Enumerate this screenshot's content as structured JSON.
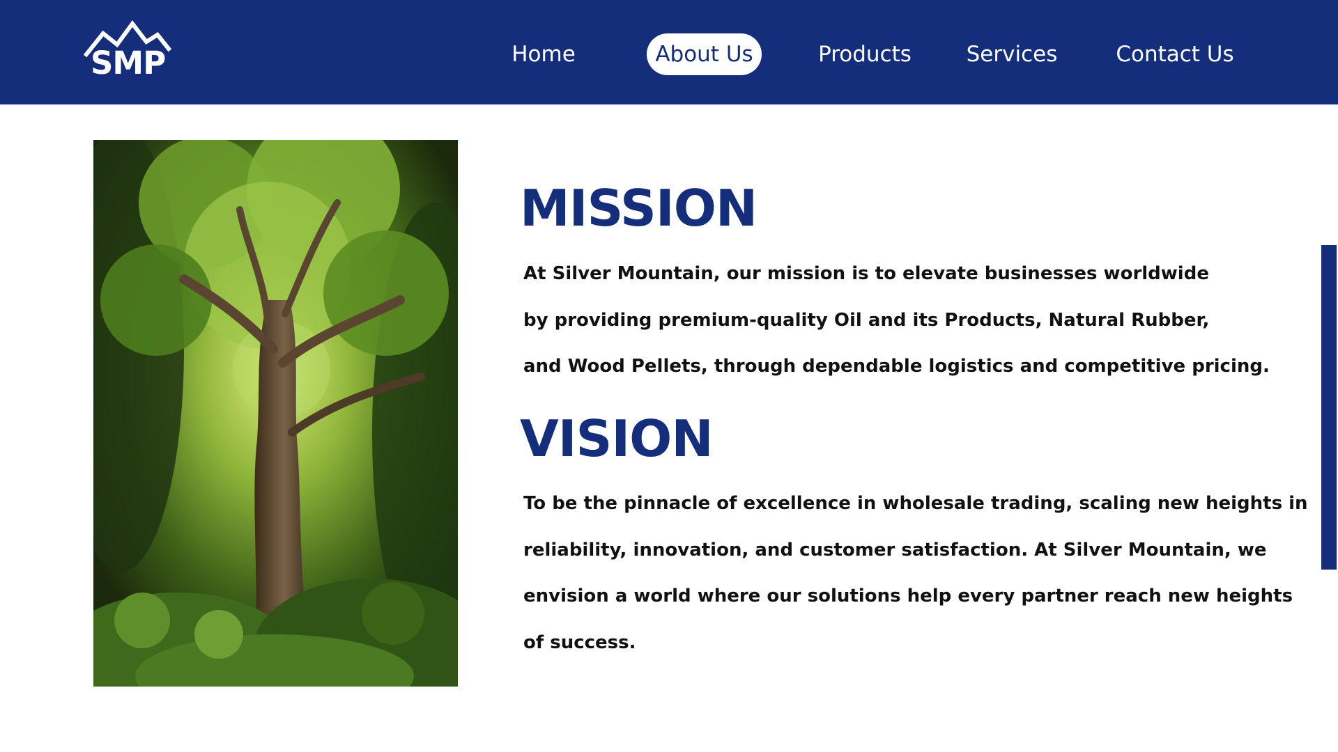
{
  "header": {
    "logo_text": "SMP",
    "nav": [
      {
        "label": "Home",
        "active": false
      },
      {
        "label": "About Us",
        "active": true
      },
      {
        "label": "Products",
        "active": false
      },
      {
        "label": "Services",
        "active": false
      },
      {
        "label": "Contact Us",
        "active": false
      }
    ]
  },
  "main": {
    "image": {
      "subject": "tree-in-forest-photo"
    },
    "mission": {
      "title": "MISSION",
      "lines": [
        "At Silver Mountain, our mission is to elevate businesses worldwide",
        "by providing premium-quality Oil and its Products, Natural Rubber,",
        "and Wood Pellets, through dependable logistics and competitive pricing."
      ]
    },
    "vision": {
      "title": "VISION",
      "lines": [
        "To be the pinnacle of excellence in wholesale trading, scaling new heights in",
        "reliability, innovation, and customer satisfaction. At Silver Mountain, we",
        "envision a world where our solutions help every partner reach new heights",
        "of success."
      ]
    }
  },
  "colors": {
    "brand_navy": "#142e7b",
    "text": "#111111",
    "background": "#ffffff"
  }
}
